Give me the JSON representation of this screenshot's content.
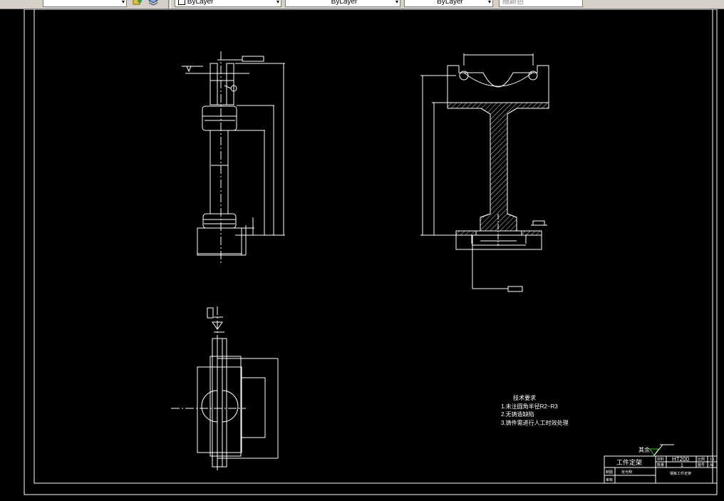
{
  "toolbar": {
    "combo_arrow": "▾",
    "color_combo": "ByLayer",
    "linetype_combo": "ByLayer",
    "lineweight_combo": "ByLayer",
    "plotstyle_combo": "随颜色"
  },
  "drawing": {
    "notes_title": "技术要求",
    "notes": [
      "1.未注圆角半径R2~R3",
      "2.无铸造缺陷",
      "3.铸件需进行人工时效处理"
    ],
    "roughness_label": "其余",
    "title_block": {
      "part_name": "工件定架",
      "material": "HT200",
      "quantity": "1",
      "scale_label": "比例",
      "scale_value": "1:1",
      "sheet_label": "图号",
      "sheet_value": "A1",
      "material_label": "材料",
      "qty_label": "数量",
      "drawing_name": "钢板工件定架",
      "designer_label": "制图",
      "designer": "张光明",
      "checker_label": "审核"
    }
  },
  "colors": {
    "background": "#000000",
    "line": "#ffffff",
    "toolbar": "#d4d0c8"
  }
}
